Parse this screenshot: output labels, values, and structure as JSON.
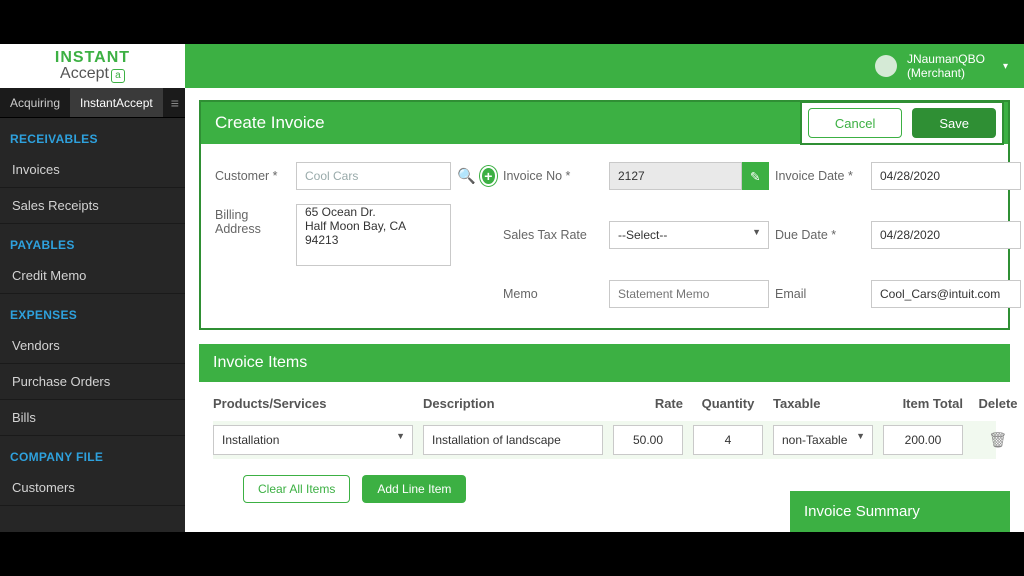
{
  "brand": {
    "line1": "INSTANT",
    "line2": "Accept",
    "badge": "a"
  },
  "user": {
    "name": "JNaumanQBO",
    "role": "(Merchant)"
  },
  "tabs": {
    "a": "Acquiring",
    "b": "InstantAccept"
  },
  "sidebar": {
    "sec1": "RECEIVABLES",
    "i1": "Invoices",
    "i2": "Sales Receipts",
    "sec2": "PAYABLES",
    "i3": "Credit Memo",
    "sec3": "EXPENSES",
    "i4": "Vendors",
    "i5": "Purchase Orders",
    "i6": "Bills",
    "sec4": "COMPANY FILE",
    "i7": "Customers"
  },
  "page": {
    "title": "Create Invoice",
    "cancel": "Cancel",
    "save": "Save",
    "labels": {
      "customer": "Customer *",
      "billing": "Billing Address",
      "invno": "Invoice No *",
      "taxrate": "Sales Tax Rate",
      "memo": "Memo",
      "invdate": "Invoice Date *",
      "due": "Due Date *",
      "email": "Email"
    },
    "values": {
      "customer": "Cool Cars",
      "billing": "65 Ocean Dr.\nHalf Moon Bay, CA 94213",
      "invno": "2127",
      "taxrate": "--Select--",
      "memo_ph": "Statement Memo",
      "invdate": "04/28/2020",
      "due": "04/28/2020",
      "email": "Cool_Cars@intuit.com"
    }
  },
  "items": {
    "title": "Invoice Items",
    "cols": {
      "a": "Products/Services",
      "b": "Description",
      "c": "Rate",
      "d": "Quantity",
      "e": "Taxable",
      "f": "Item Total",
      "g": "Delete"
    },
    "row": {
      "prod": "Installation",
      "desc": "Installation of landscape",
      "rate": "50.00",
      "qty": "4",
      "tax": "non-Taxable",
      "total": "200.00"
    },
    "clear": "Clear All Items",
    "add": "Add Line Item"
  },
  "summary": {
    "title": "Invoice Summary"
  }
}
